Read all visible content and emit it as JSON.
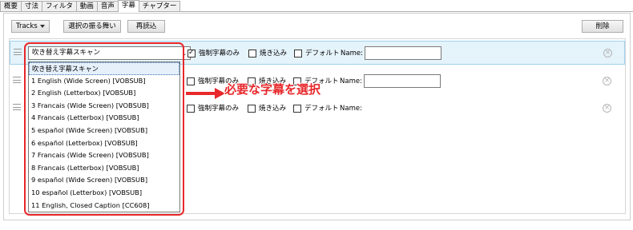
{
  "tabs": [
    "概要",
    "寸法",
    "フィルタ",
    "動画",
    "音声",
    "字幕",
    "チャプター"
  ],
  "toolbar": {
    "tracks": "Tracks",
    "behavior": "選択の振る舞い",
    "reload": "再読込",
    "delete": "削除"
  },
  "row_labels": {
    "forced": "強制字幕のみ",
    "burn": "焼き込み",
    "default": "デフォルト",
    "name": "Name:"
  },
  "rows": [
    {
      "track": "吹き替え字幕スキャン",
      "forced": true,
      "burn": false,
      "default": false
    },
    {
      "track": "",
      "forced": false,
      "burn": false,
      "default": false
    },
    {
      "track": "",
      "forced": false,
      "burn": false,
      "default": false
    }
  ],
  "dropdown": {
    "options": [
      "吹き替え字幕スキャン",
      "1 English (Wide Screen) [VOBSUB]",
      "2 English (Letterbox) [VOBSUB]",
      "3 Francais (Wide Screen) [VOBSUB]",
      "4 Francais (Letterbox) [VOBSUB]",
      "5 español (Wide Screen) [VOBSUB]",
      "6 español (Letterbox) [VOBSUB]",
      "7 Francais (Wide Screen) [VOBSUB]",
      "8 Francais (Letterbox) [VOBSUB]",
      "9 español (Wide Screen) [VOBSUB]",
      "10 español (Letterbox) [VOBSUB]",
      "11 English, Closed Caption [CC608]"
    ],
    "highlighted": 0
  },
  "annotation": {
    "text": "必要な字幕を選択",
    "color": "#e8282b"
  }
}
